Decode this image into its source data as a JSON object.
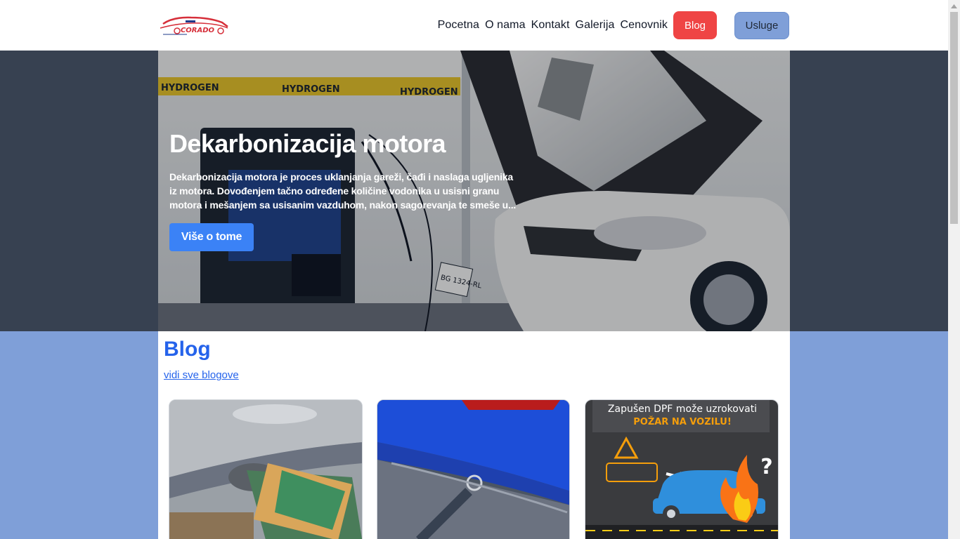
{
  "header": {
    "logo_alt": "CORADO",
    "nav": [
      "Pocetna",
      "O nama",
      "Kontakt",
      "Galerija",
      "Cenovnik"
    ],
    "blog_button": "Blog",
    "usluge_button": "Usluge"
  },
  "hero": {
    "title": "Dekarbonizacija motora",
    "text": "Dekarbonizacija motora je proces uklanjanja gareži, čađi i naslaga ugljenika iz motora. Dovođenjem tačno određene količine vodonika u usisni granu motora i mešanjem sa usisanim vazduhom, nakon sagorevanja te smeše u...",
    "button": "Više o tome",
    "banner_text": "HYDROGEN",
    "plate_text": "BG 1324-RL"
  },
  "blog": {
    "title": "Blog",
    "see_all": "vidi sve blogove",
    "cards": [
      {
        "image": "exhaust-money"
      },
      {
        "image": "exhaust-tailpipe"
      },
      {
        "image": "dpf-fire-infographic",
        "caption_line1": "Zapušen DPF može uzrokovati",
        "caption_line2": "POŽAR NA VOZILU!"
      }
    ]
  },
  "colors": {
    "accent_blue": "#3b82f6",
    "link_blue": "#2563eb",
    "blog_red": "#ef4444",
    "usluge_blue": "#7f9fd8",
    "hero_band": "#374151"
  }
}
